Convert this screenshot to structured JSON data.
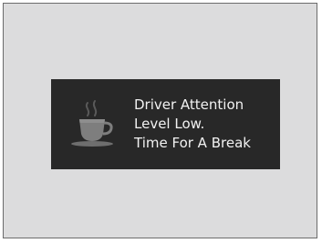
{
  "alert": {
    "icon": "coffee-cup-icon",
    "lines": [
      "Driver Attention",
      "Level Low.",
      "Time For A Break"
    ]
  },
  "colors": {
    "panel_background": "#282828",
    "text": "#f2f2f2",
    "screen_background": "#dcdcdd"
  }
}
